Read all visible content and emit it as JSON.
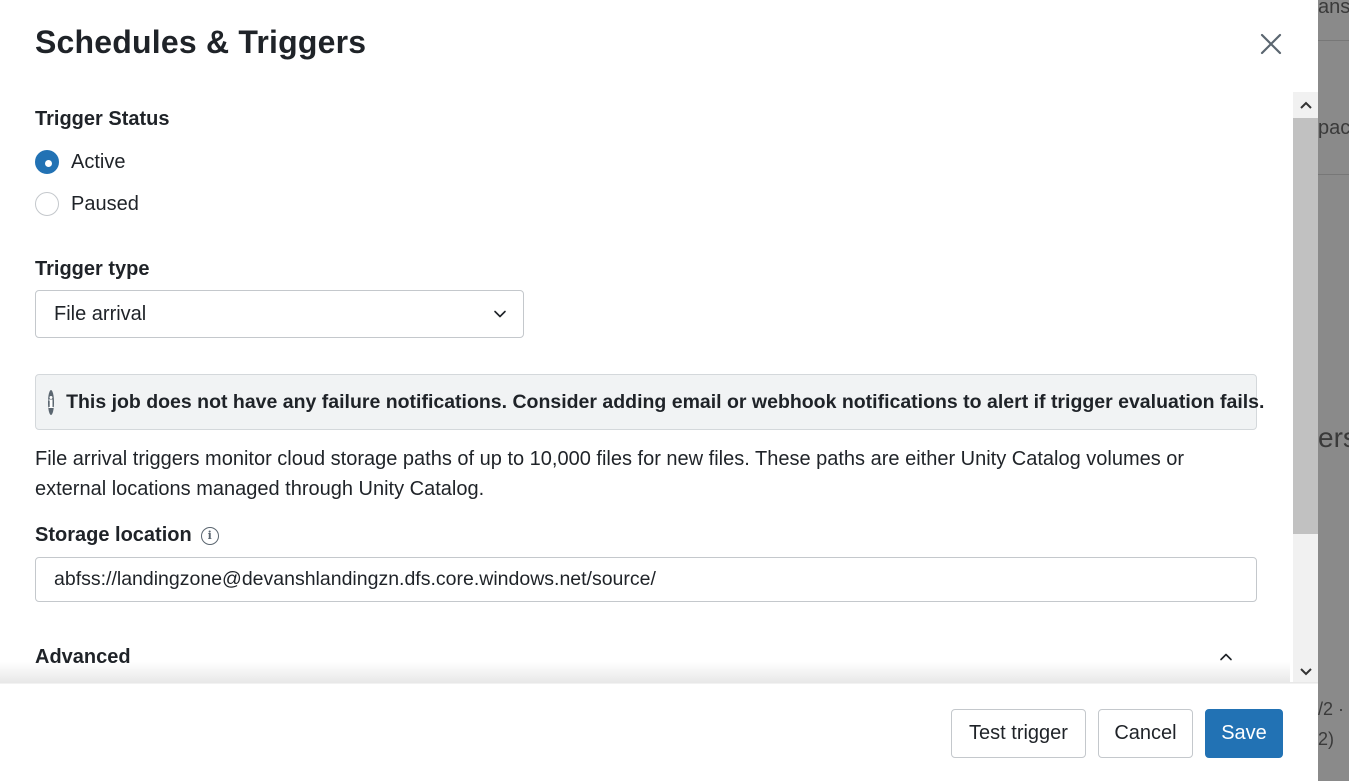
{
  "modal": {
    "title": "Schedules & Triggers",
    "close_icon": "close-icon"
  },
  "trigger_status": {
    "label": "Trigger Status",
    "options": [
      {
        "label": "Active",
        "selected": true
      },
      {
        "label": "Paused",
        "selected": false
      }
    ]
  },
  "trigger_type": {
    "label": "Trigger type",
    "selected": "File arrival"
  },
  "alert": {
    "icon": "info-icon",
    "text": "This job does not have any failure notifications. Consider adding email or webhook notifications to alert if trigger evaluation fails."
  },
  "description": "File arrival triggers monitor cloud storage paths of up to 10,000 files for new files. These paths are either Unity Catalog volumes or external locations managed through Unity Catalog.",
  "storage_location": {
    "label": "Storage location",
    "value": "abfss://landingzone@devanshlandingzn.dfs.core.windows.net/source/"
  },
  "advanced": {
    "label": "Advanced",
    "expanded": true
  },
  "footer": {
    "test_label": "Test trigger",
    "cancel_label": "Cancel",
    "save_label": "Save"
  },
  "background": {
    "peek_1": "ansh",
    "peek_2": "pack",
    "peek_3": "ers",
    "peek_4": "/2 ·",
    "peek_5": "2)"
  },
  "colors": {
    "primary": "#2272b4",
    "alert_bg": "#f1f3f4",
    "text": "#1f2328"
  }
}
